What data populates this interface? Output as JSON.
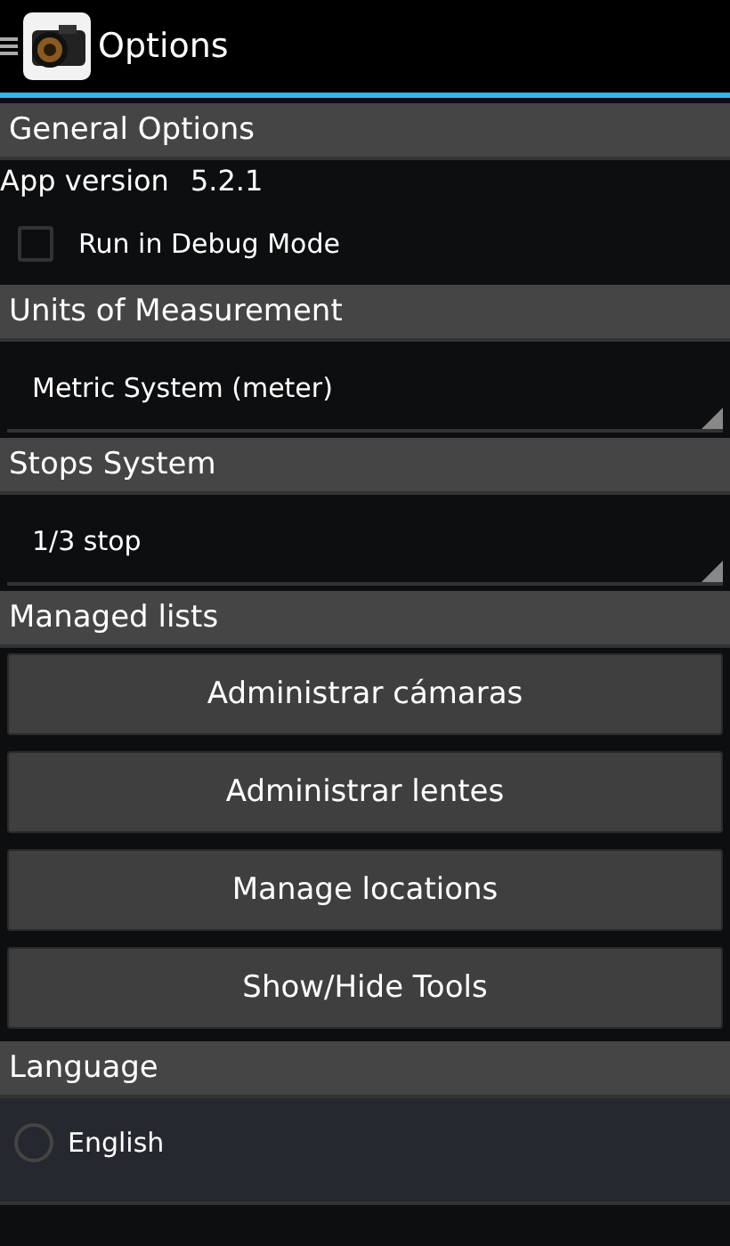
{
  "action_bar": {
    "title": "Options"
  },
  "sections": [
    {
      "title": "General Options",
      "items": [
        {
          "kind": "info",
          "label": "App version",
          "value": "5.2.1"
        },
        {
          "kind": "checkbox",
          "label": "Run in Debug Mode",
          "checked": false
        }
      ]
    },
    {
      "title": "Units of Measurement",
      "items": [
        {
          "kind": "dropdown",
          "value": "Metric System (meter)"
        }
      ]
    },
    {
      "title": "Stops System",
      "items": [
        {
          "kind": "dropdown",
          "value": "1/3 stop"
        }
      ]
    },
    {
      "title": "Managed lists",
      "items": [
        {
          "kind": "button",
          "label": "Administrar cámaras"
        },
        {
          "kind": "button",
          "label": "Administrar lentes"
        },
        {
          "kind": "button",
          "label": "Manage locations"
        },
        {
          "kind": "button",
          "label": "Show/Hide Tools"
        }
      ]
    },
    {
      "title": "Language",
      "items": [
        {
          "kind": "radio",
          "label": "English",
          "selected": false
        }
      ]
    }
  ]
}
